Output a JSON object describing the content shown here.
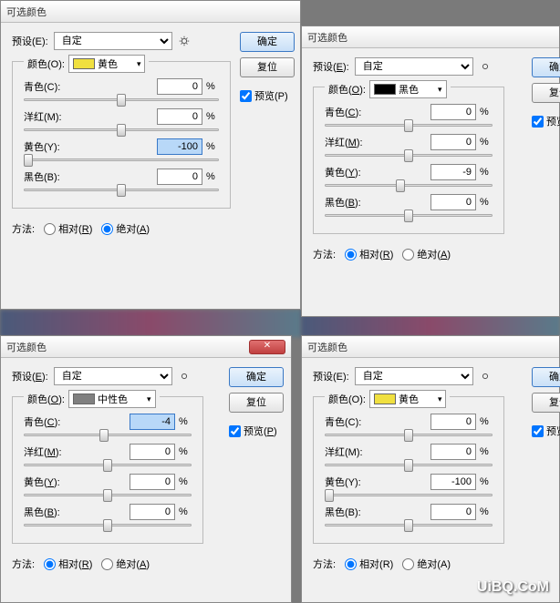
{
  "dialogs": [
    {
      "title": "可选颜色",
      "preset_label": "预设(E):",
      "preset_value": "自定",
      "color_label": "颜色(O):",
      "color_name": "黄色",
      "color_hex": "#f0e040",
      "sliders": [
        {
          "label": "青色(C):",
          "value": "0",
          "pos": 50
        },
        {
          "label": "洋红(M):",
          "value": "0",
          "pos": 50
        },
        {
          "label": "黄色(Y):",
          "value": "-100",
          "pos": 2,
          "hl": true
        },
        {
          "label": "黑色(B):",
          "value": "0",
          "pos": 50
        }
      ],
      "method_label": "方法:",
      "rel_label": "相对(R)",
      "abs_label": "绝对(A)",
      "method": "absolute",
      "ok": "确定",
      "reset": "复位",
      "preview": "预览(P)"
    },
    {
      "title": "可选颜色",
      "preset_label": "预设(E):",
      "preset_value": "自定",
      "color_label": "颜色(O):",
      "color_name": "黑色",
      "color_hex": "#000000",
      "sliders": [
        {
          "label": "青色(C):",
          "value": "0",
          "pos": 50
        },
        {
          "label": "洋红(M):",
          "value": "0",
          "pos": 50
        },
        {
          "label": "黄色(Y):",
          "value": "-9",
          "pos": 45
        },
        {
          "label": "黑色(B):",
          "value": "0",
          "pos": 50
        }
      ],
      "method_label": "方法:",
      "rel_label": "相对(R)",
      "abs_label": "绝对(A)",
      "method": "relative",
      "ok": "确定",
      "reset": "复位",
      "preview": "预览(P)"
    },
    {
      "title": "可选颜色",
      "preset_label": "预设(E):",
      "preset_value": "自定",
      "color_label": "颜色(O):",
      "color_name": "中性色",
      "color_hex": "#808080",
      "sliders": [
        {
          "label": "青色(C):",
          "value": "-4",
          "pos": 48,
          "hl": true
        },
        {
          "label": "洋红(M):",
          "value": "0",
          "pos": 50
        },
        {
          "label": "黄色(Y):",
          "value": "0",
          "pos": 50
        },
        {
          "label": "黑色(B):",
          "value": "0",
          "pos": 50
        }
      ],
      "method_label": "方法:",
      "rel_label": "相对(R)",
      "abs_label": "绝对(A)",
      "method": "relative",
      "ok": "确定",
      "reset": "复位",
      "preview": "预览(P)"
    },
    {
      "title": "可选颜色",
      "preset_label": "预设(E):",
      "preset_value": "自定",
      "color_label": "颜色(O):",
      "color_name": "黄色",
      "color_hex": "#f0e040",
      "sliders": [
        {
          "label": "青色(C):",
          "value": "0",
          "pos": 50
        },
        {
          "label": "洋红(M):",
          "value": "0",
          "pos": 50
        },
        {
          "label": "黄色(Y):",
          "value": "-100",
          "pos": 2
        },
        {
          "label": "黑色(B):",
          "value": "0",
          "pos": 50
        }
      ],
      "method_label": "方法:",
      "rel_label": "相对(R)",
      "abs_label": "绝对(A)",
      "method": "relative",
      "ok": "确定",
      "reset": "复位",
      "preview": "预览(P)"
    }
  ],
  "percent": "%",
  "watermark": "UiBQ.CoM"
}
